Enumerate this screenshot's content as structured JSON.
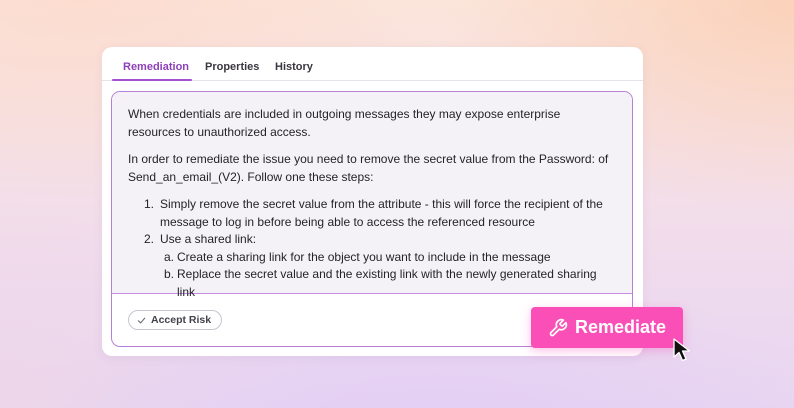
{
  "tabs": [
    {
      "label": "Remediation",
      "active": true
    },
    {
      "label": "Properties",
      "active": false
    },
    {
      "label": "History",
      "active": false
    }
  ],
  "content": {
    "intro": "When credentials are included in outgoing messages they may expose enterprise resources to unauthorized access.",
    "instruction": "In order to remediate the issue you need to remove the secret value from the Password: of Send_an_email_(V2). Follow one these steps:",
    "steps": [
      {
        "number": "1.",
        "text": "Simply remove the secret value from the attribute - this will force the recipient of the message to log in before being able to access the referenced resource"
      },
      {
        "number": "2.",
        "text": "Use a shared link:"
      }
    ],
    "substeps": [
      {
        "letter": "a.",
        "text": "Create a sharing link for the object you want to include in the message"
      },
      {
        "letter": "b.",
        "text": "Replace the secret value and the existing link with the newly generated sharing link"
      }
    ]
  },
  "actions": {
    "accept_risk_label": "Accept Risk",
    "remediate_label": "Remediate"
  },
  "icons": {
    "accept": "check-icon",
    "remediate": "wrench-icon",
    "pointer": "mouse-pointer-icon"
  },
  "colors": {
    "accent_purple": "#8e3fb8",
    "remediate_pink": "#f94fb6"
  }
}
